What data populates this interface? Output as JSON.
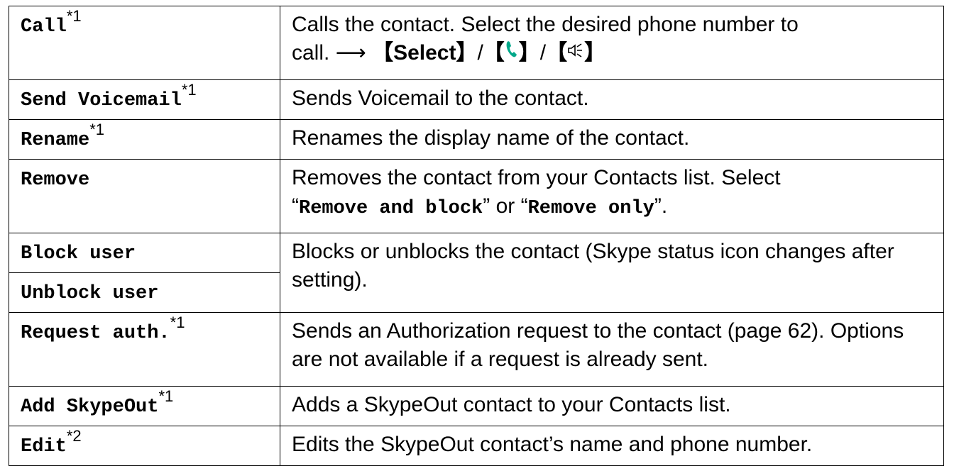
{
  "rows": [
    {
      "option": "Call",
      "note": "*1",
      "desc_line1": "Calls the contact. Select the desired phone number to",
      "desc_line2_prefix": "call.",
      "arrow": "⟶",
      "key_select": "Select",
      "bracket_open": "【",
      "bracket_close": "】",
      "separator": "/"
    },
    {
      "option": "Send Voicemail",
      "note": "*1",
      "desc": "Sends Voicemail to the contact."
    },
    {
      "option": "Rename",
      "note": "*1",
      "desc": "Renames the display name of the contact."
    },
    {
      "option": "Remove",
      "desc_part1": "Removes the contact from your Contacts list. Select",
      "quote_open": "“",
      "quote_close": "”",
      "choice1": "Remove and block",
      "or_word": " or ",
      "choice2": "Remove only",
      "end_period": "."
    },
    {
      "option": "Block user",
      "desc": "Blocks or unblocks the contact (Skype status icon changes after setting)."
    },
    {
      "option": "Unblock user"
    },
    {
      "option": "Request auth.",
      "note": "*1",
      "desc": "Sends an Authorization request to the contact (page 62). Options are not available if a request is already sent."
    },
    {
      "option": "Add SkypeOut",
      "note": "*1",
      "desc": "Adds a SkypeOut contact to your Contacts list."
    },
    {
      "option": "Edit",
      "note": "*2",
      "desc": "Edits the SkypeOut contact’s name and phone number."
    }
  ],
  "icons": {
    "talk_key": "phone-handset-icon",
    "speaker_key": "speakerphone-icon",
    "talk_color": "#00a88a"
  }
}
